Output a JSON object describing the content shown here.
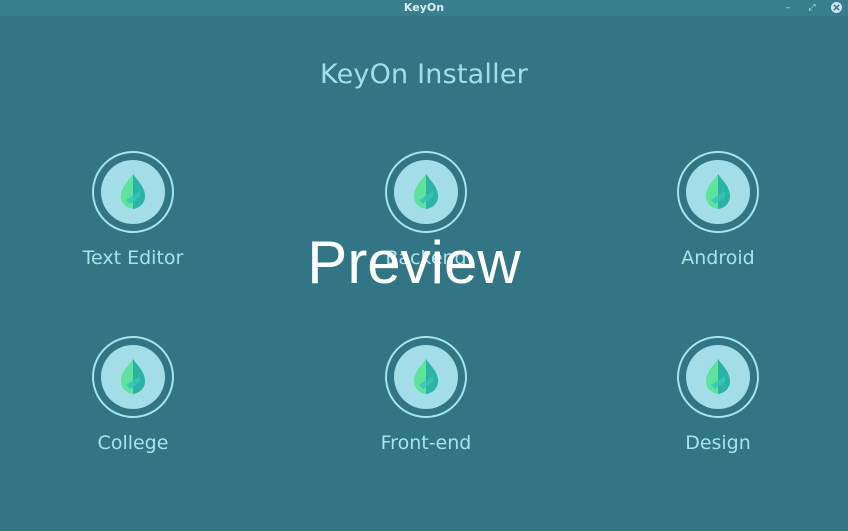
{
  "window": {
    "title": "KeyOn",
    "minimize_glyph": "–",
    "maximize_glyph": "⤢",
    "close_icon": "close-icon"
  },
  "heading": "KeyOn Installer",
  "options": [
    {
      "label": "Text Editor",
      "icon": "leaf-icon"
    },
    {
      "label": "Backend",
      "icon": "leaf-icon"
    },
    {
      "label": "Android",
      "icon": "leaf-icon"
    },
    {
      "label": "College",
      "icon": "leaf-icon"
    },
    {
      "label": "Front-end",
      "icon": "leaf-icon"
    },
    {
      "label": "Design",
      "icon": "leaf-icon"
    }
  ],
  "watermark": "Preview",
  "colors": {
    "background": "#327585",
    "accent": "#a7e4ee",
    "leaf_light": "#5ee39a",
    "leaf_dark": "#2bb3a8"
  }
}
